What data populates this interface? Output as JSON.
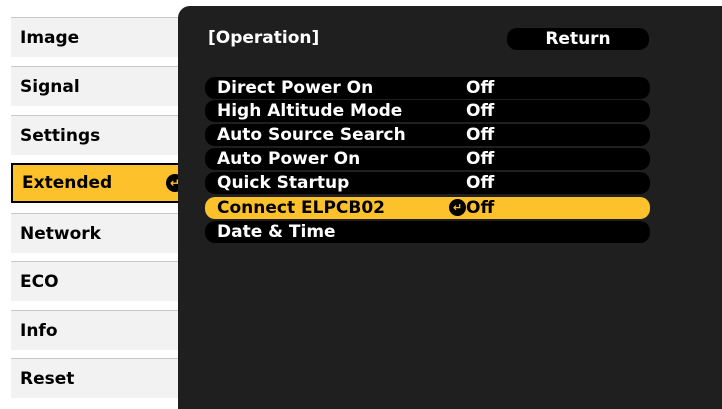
{
  "sidebar": {
    "items": [
      {
        "label": "Image"
      },
      {
        "label": "Signal"
      },
      {
        "label": "Settings"
      },
      {
        "label": "Extended",
        "active": true
      },
      {
        "label": "Network"
      },
      {
        "label": "ECO"
      },
      {
        "label": "Info"
      },
      {
        "label": "Reset"
      }
    ]
  },
  "panel": {
    "title": "[Operation]",
    "return_label": "Return",
    "rows": [
      {
        "label": "Direct Power On",
        "value": "Off"
      },
      {
        "label": "High Altitude Mode",
        "value": "Off"
      },
      {
        "label": "Auto Source Search",
        "value": "Off"
      },
      {
        "label": "Auto Power On",
        "value": "Off"
      },
      {
        "label": "Quick Startup",
        "value": "Off"
      },
      {
        "label": "Connect ELPCB02",
        "value": "Off",
        "selected": true
      },
      {
        "label": "Date & Time",
        "value": ""
      }
    ]
  },
  "icons": {
    "enter": "enter-return-icon"
  },
  "colors": {
    "accent": "#fdc12b",
    "panel_bg": "#1f1f1f",
    "row_bg": "#000000",
    "tab_bg": "#f2f2f2"
  }
}
